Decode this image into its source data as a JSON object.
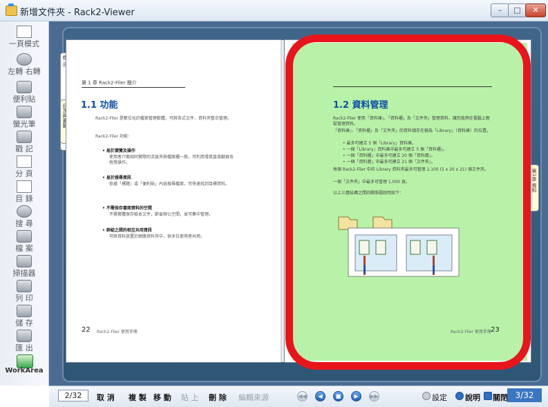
{
  "window": {
    "title": "新增文件夾 - Rack2-Viewer",
    "buttons": {
      "minimize": "–",
      "maximize": "□",
      "close": "✕"
    }
  },
  "toolbar": {
    "items": [
      {
        "label": "一頁模式",
        "icon": "single-page-icon"
      },
      {
        "label": "左轉 右轉",
        "icon": "rotate-icon"
      },
      {
        "label": "便利貼",
        "icon": "sticky-note-icon"
      },
      {
        "label": "螢光筆",
        "icon": "highlighter-icon"
      },
      {
        "label": "戳 記",
        "icon": "stamp-icon"
      },
      {
        "label": "分 頁",
        "icon": "split-page-icon"
      },
      {
        "label": "目 錄",
        "icon": "toc-icon"
      },
      {
        "label": "搜 尋",
        "icon": "search-icon"
      },
      {
        "label": "檔 案",
        "icon": "file-icon"
      },
      {
        "label": "掃描器",
        "icon": "scanner-icon"
      },
      {
        "label": "列 印",
        "icon": "printer-icon"
      },
      {
        "label": "儲 存",
        "icon": "save-icon"
      },
      {
        "label": "匯 出",
        "icon": "export-icon"
      },
      {
        "label": "WorkArea",
        "icon": "workarea-icon"
      }
    ]
  },
  "book": {
    "left_tab": "標 示",
    "left_tab2": "目次與書籤",
    "right_tab": "第1章 資料",
    "left_page": {
      "chapter": "第 1 章 Rack2-Filer 簡介",
      "title": "1.1  功能",
      "intro": "Rack2-Filer 是數位化的檔案管理軟體，可將各式文件、資料夾整合管理。",
      "intro2": "Rack2-Filer 功能：",
      "bullets": [
        {
          "head": "• 易於瀏覽及操作",
          "body": "使用者介面如同實際的活頁夾與檔案櫃一般，可利用滑鼠直接翻頁及拖曳操作。"
        },
        {
          "head": "• 易於搜尋資訊",
          "body": "依據「標題」或「便利貼」內容搜尋檔案，可快速找到目標資料。"
        },
        {
          "head": "• 不需保存書面資料的空間",
          "body": "不需實體保存紙本文件，節省辦公空間，並可集中管理。"
        },
        {
          "head": "• 群組之間的相互共用資訊",
          "body": "可將資料放置於網路資料夾中，供多位使用者共用。"
        }
      ],
      "page_number": "22",
      "footer": "Rack2-Filer 使用手冊"
    },
    "right_page": {
      "title": "1.2  資料管理",
      "paragraphs": [
        "Rack2-Filer 使用「資料庫」、「資料櫃」及「文件夾」管理資料，讓您能夠在電腦上輕鬆管理資料。",
        "「資料庫」、「資料櫃」及「文件夾」的資料儲存在稱為「Library」（資料庫）的位置。",
        "• 最多可建立 5 個「Library」資料庫。",
        "• 一個「Library」資料庫中最多可建立 5 個「資料櫃」。",
        "• 一個「資料櫃」中最多可建立 20 個「資料層」。",
        "• 一個「資料層」中最多可建立 21 個「文件夾」。",
        "每個 Rack2-Filer 中的 Library 資料夾最多可管理 2,100 (5 x 20 x 21) 個文件夾。",
        "一個「文件夾」中最多可管理 1,000 頁。",
        "以上三層結構之間的關係圖說明如下："
      ],
      "page_number": "23",
      "footer": "Rack2-Filer 使用手冊"
    }
  },
  "bottombar": {
    "page_input": "2/32",
    "buttons": [
      "取 消",
      "複 製",
      "移 動",
      "貼 上",
      "刪 除"
    ],
    "edit_source": "編輯來源",
    "settings": "設定",
    "help": "說明",
    "close": "關閉",
    "page_count": "3/32"
  },
  "colors": {
    "highlight": "#b8f2a8",
    "annotation": "#e8151c",
    "heading": "#0e4fa3",
    "frame": "#4a6c92"
  }
}
